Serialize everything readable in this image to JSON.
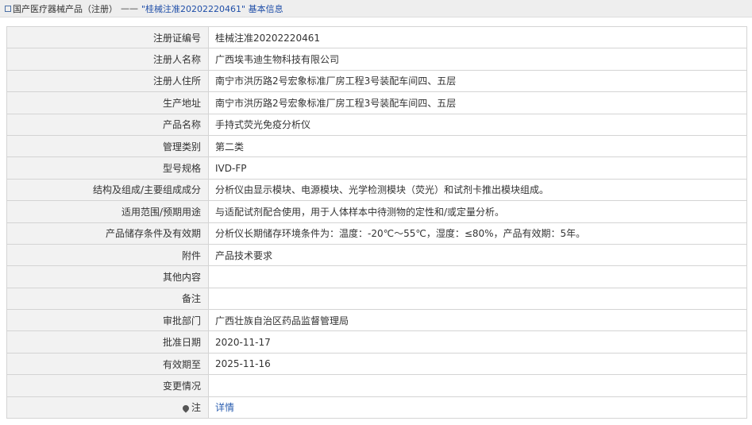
{
  "breadcrumb": {
    "root": "国产医疗器械产品（注册）",
    "separator": "——",
    "current": "\"桂械注准20202220461\" 基本信息"
  },
  "rows": [
    {
      "label": "注册证编号",
      "value": "桂械注准20202220461"
    },
    {
      "label": "注册人名称",
      "value": "广西埃韦迪生物科技有限公司"
    },
    {
      "label": "注册人住所",
      "value": "南宁市洪历路2号宏象标准厂房工程3号装配车间四、五层"
    },
    {
      "label": "生产地址",
      "value": "南宁市洪历路2号宏象标准厂房工程3号装配车间四、五层"
    },
    {
      "label": "产品名称",
      "value": "手持式荧光免疫分析仪"
    },
    {
      "label": "管理类别",
      "value": "第二类"
    },
    {
      "label": "型号规格",
      "value": "IVD-FP"
    },
    {
      "label": "结构及组成/主要组成成分",
      "value": "分析仪由显示模块、电源模块、光学检测模块（荧光）和试剂卡推出模块组成。"
    },
    {
      "label": "适用范围/预期用途",
      "value": "与适配试剂配合使用，用于人体样本中待测物的定性和/或定量分析。"
    },
    {
      "label": "产品储存条件及有效期",
      "value": "分析仪长期储存环境条件为：温度：-20℃～55℃，湿度：≤80%，产品有效期：5年。"
    },
    {
      "label": "附件",
      "value": "产品技术要求"
    },
    {
      "label": "其他内容",
      "value": ""
    },
    {
      "label": "备注",
      "value": ""
    },
    {
      "label": "审批部门",
      "value": "广西壮族自治区药品监督管理局"
    },
    {
      "label": "批准日期",
      "value": "2020-11-17"
    },
    {
      "label": "有效期至",
      "value": "2025-11-16"
    },
    {
      "label": "变更情况",
      "value": ""
    }
  ],
  "note_row": {
    "label": "注",
    "link": "详情"
  }
}
